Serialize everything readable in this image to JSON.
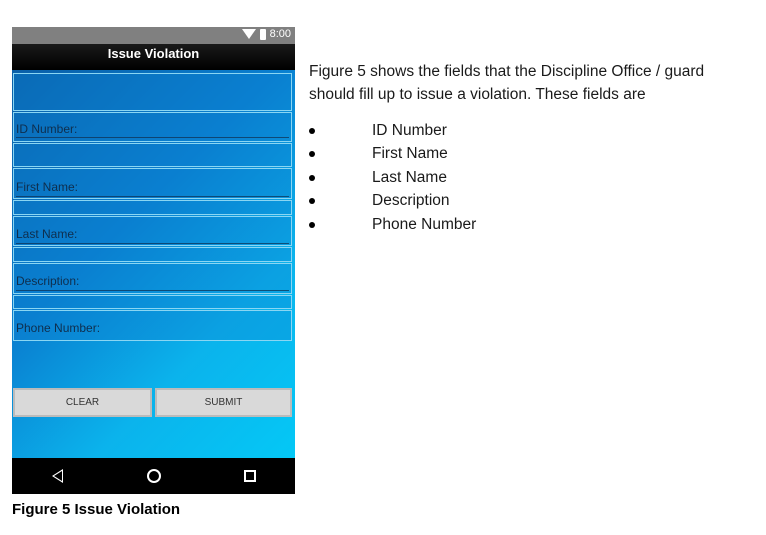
{
  "phone": {
    "status_time": "8:00",
    "title": "Issue Violation",
    "fields": [
      {
        "label": "ID Number:"
      },
      {
        "label": "First Name:"
      },
      {
        "label": "Last Name:"
      },
      {
        "label": "Description:"
      },
      {
        "label": "Phone Number:"
      }
    ],
    "buttons": {
      "clear": "CLEAR",
      "submit": "SUBMIT"
    },
    "colors": {
      "screen_top": "#0a5fa8",
      "screen_bottom": "#04c8f6",
      "button": "#d9d9d9"
    }
  },
  "caption": "Figure 5 Issue Violation",
  "paragraph": "Figure 5 shows the fields that the Discipline Office / guard should fill up to issue a violation. These fields are",
  "fields_list": [
    "ID Number",
    "First Name",
    "Last Name",
    "Description",
    "Phone Number"
  ]
}
